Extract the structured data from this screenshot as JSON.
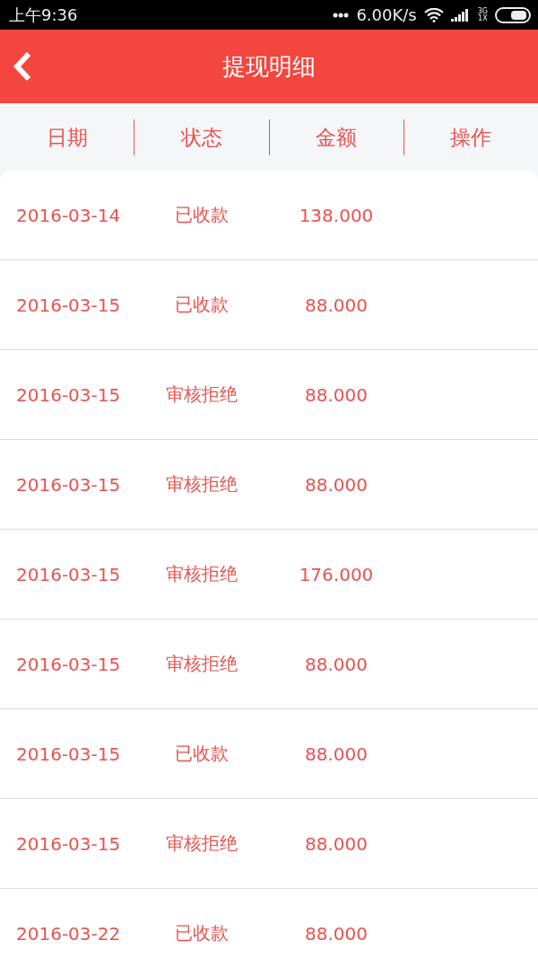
{
  "status_bar": {
    "time": "上午9:36",
    "speed": "6.00K/s",
    "network": "3G\n1X"
  },
  "header": {
    "title": "提现明细"
  },
  "columns": [
    "日期",
    "状态",
    "金额",
    "操作"
  ],
  "rows": [
    {
      "date": "2016-03-14",
      "status": "已收款",
      "amount": "138.000"
    },
    {
      "date": "2016-03-15",
      "status": "已收款",
      "amount": "88.000"
    },
    {
      "date": "2016-03-15",
      "status": "审核拒绝",
      "amount": "88.000"
    },
    {
      "date": "2016-03-15",
      "status": "审核拒绝",
      "amount": "88.000"
    },
    {
      "date": "2016-03-15",
      "status": "审核拒绝",
      "amount": "176.000"
    },
    {
      "date": "2016-03-15",
      "status": "审核拒绝",
      "amount": "88.000"
    },
    {
      "date": "2016-03-15",
      "status": "已收款",
      "amount": "88.000"
    },
    {
      "date": "2016-03-15",
      "status": "审核拒绝",
      "amount": "88.000"
    },
    {
      "date": "2016-03-22",
      "status": "已收款",
      "amount": "88.000"
    }
  ]
}
